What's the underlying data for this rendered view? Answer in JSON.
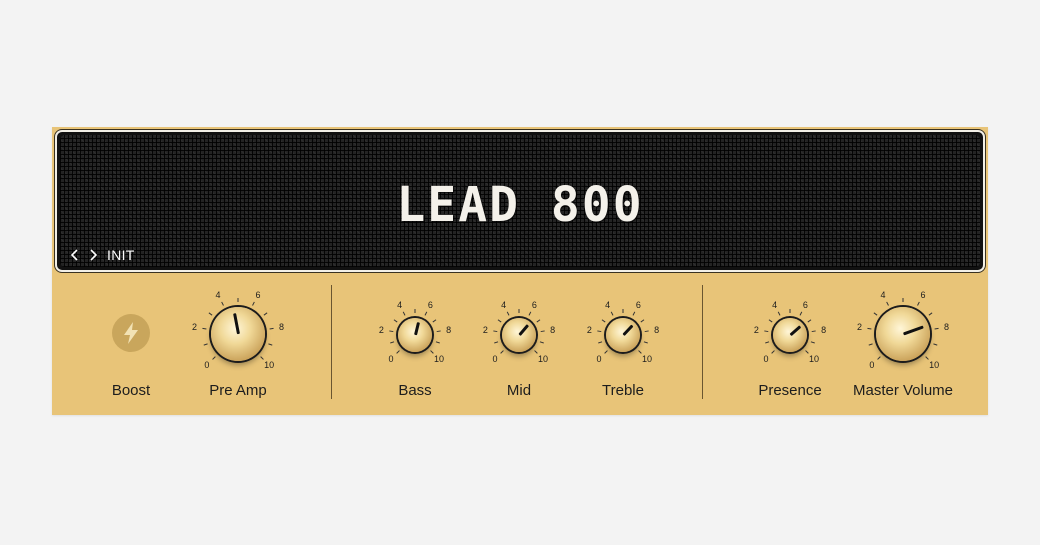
{
  "amp": {
    "logo": "LEAD 800",
    "preset": {
      "name": "INIT",
      "prev_icon": "chevron-left-icon",
      "next_icon": "chevron-right-icon"
    }
  },
  "boost": {
    "label": "Boost",
    "icon": "lightning-bolt-icon",
    "active": false
  },
  "scale": {
    "ticks": [
      "0",
      "2",
      "4",
      "6",
      "8",
      "10"
    ]
  },
  "knobs": [
    {
      "id": "pre-amp",
      "label": "Pre Amp",
      "value": 4.6
    },
    {
      "id": "bass",
      "label": "Bass",
      "value": 5.5
    },
    {
      "id": "mid",
      "label": "Mid",
      "value": 6.5
    },
    {
      "id": "treble",
      "label": "Treble",
      "value": 6.6
    },
    {
      "id": "presence",
      "label": "Presence",
      "value": 6.8
    },
    {
      "id": "master-volume",
      "label": "Master Volume",
      "value": 7.6
    }
  ],
  "colors": {
    "panel": "#e8c478",
    "grille": "#232323",
    "knob_gold": "#e6c57c"
  }
}
